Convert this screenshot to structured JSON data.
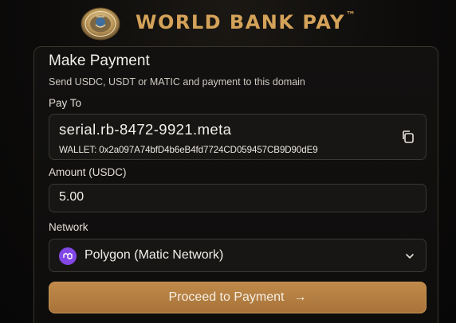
{
  "header": {
    "brand_name": "WORLD BANK PAY",
    "trademark": "™",
    "logo_icon": "world-bank-seal-icon"
  },
  "card": {
    "title": "Make Payment",
    "subtitle": "Send USDC, USDT or MATIC and payment to this domain",
    "pay_to": {
      "label": "Pay To",
      "domain": "serial.rb-8472-9921.meta",
      "wallet_line": "WALLET: 0x2a097A74bfD4b6eB4fd7724CD059457CB9D90dE9",
      "copy_icon": "copy-icon"
    },
    "amount": {
      "label": "Amount (USDC)",
      "value": "5.00"
    },
    "network": {
      "label": "Network",
      "selected": "Polygon (Matic Network)",
      "network_icon": "polygon-icon",
      "dropdown_icon": "chevron-down-icon"
    },
    "cta": {
      "label": "Proceed to Payment",
      "arrow": "→"
    }
  },
  "colors": {
    "accent_gold": "#d4a259",
    "button_gold": "#b27d42",
    "polygon_purple": "#8247e5",
    "background": "#0c0b0a"
  }
}
